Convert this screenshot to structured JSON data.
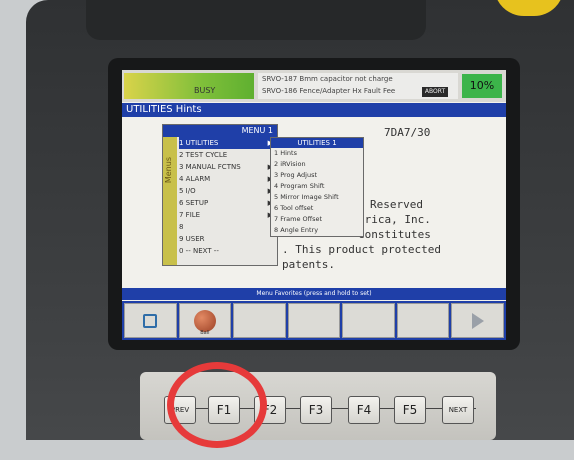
{
  "status": {
    "busy_text": "BUSY",
    "message_line1": "SRVO-187 Bmm capacitor not charge",
    "message_line2": "SRVO-186 Fence/Adapter Hx Fault Fee",
    "message_tag": "ABORT",
    "override": "10%"
  },
  "screen_title": "UTILITIES Hints",
  "hints": [
    "7DA7/30",
    "Reserved",
    "erica, Inc.",
    "constitutes",
    ". This product protected",
    "patents."
  ],
  "menu": {
    "header": "MENU 1",
    "side_tab": "Menus",
    "items": [
      {
        "label": "1 UTILITIES",
        "selected": true,
        "arrow": "▶"
      },
      {
        "label": "2 TEST CYCLE",
        "selected": false,
        "arrow": ""
      },
      {
        "label": "3 MANUAL FCTNS",
        "selected": false,
        "arrow": "▶"
      },
      {
        "label": "4 ALARM",
        "selected": false,
        "arrow": "▶"
      },
      {
        "label": "5 I/O",
        "selected": false,
        "arrow": "▶"
      },
      {
        "label": "6 SETUP",
        "selected": false,
        "arrow": "▶"
      },
      {
        "label": "7 FILE",
        "selected": false,
        "arrow": "▶"
      },
      {
        "label": "8",
        "selected": false,
        "arrow": ""
      },
      {
        "label": "9 USER",
        "selected": false,
        "arrow": ""
      },
      {
        "label": "0 -- NEXT --",
        "selected": false,
        "arrow": ""
      }
    ]
  },
  "submenu": {
    "header": "UTILITIES 1",
    "items": [
      "1 Hints",
      "2 iRVision",
      "3 Prog Adjust",
      "4 Program Shift",
      "5 Mirror Image Shift",
      "6 Tool offset",
      "7 Frame Offset",
      "8 Angle Entry"
    ]
  },
  "prompt": "Menu Favorites (press and hold to set)",
  "fkeys": [
    {
      "icon": "book-icon",
      "label": ""
    },
    {
      "icon": "ball-icon",
      "label": "Ball"
    },
    {
      "icon": "",
      "label": ""
    },
    {
      "icon": "",
      "label": ""
    },
    {
      "icon": "",
      "label": ""
    },
    {
      "icon": "",
      "label": ""
    },
    {
      "icon": "play-icon",
      "label": ""
    }
  ],
  "hardware_keys": [
    "PREV",
    "F1",
    "F2",
    "F3",
    "F4",
    "F5",
    "NEXT"
  ],
  "colors": {
    "title_bar": "#1f3fa8",
    "override": "#3cb44a",
    "highlight_circle": "#e63a3a"
  }
}
